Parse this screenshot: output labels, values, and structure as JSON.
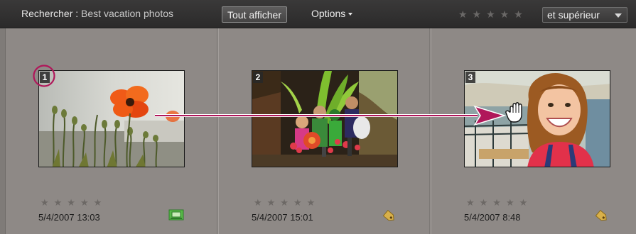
{
  "search": {
    "label": "Rechercher :",
    "query": "Best vacation photos",
    "show_all_label": "Tout afficher",
    "options_label": "Options",
    "rating_stars": "★★★★★",
    "rating_condition": "et supérieur"
  },
  "photos": [
    {
      "number": "1",
      "stars": "★★★★★",
      "date": "5/4/2007 13:03",
      "badge_icon": "slideshow-icon"
    },
    {
      "number": "2",
      "stars": "★★★★★",
      "date": "5/4/2007 15:01",
      "badge_icon": "tag-icon"
    },
    {
      "number": "3",
      "stars": "★★★★★",
      "date": "5/4/2007 8:48",
      "badge_icon": "tag-icon"
    }
  ],
  "colors": {
    "annotation": "#b0175a",
    "panel": "#8e8986",
    "toolbar": "#2f2e2e"
  }
}
